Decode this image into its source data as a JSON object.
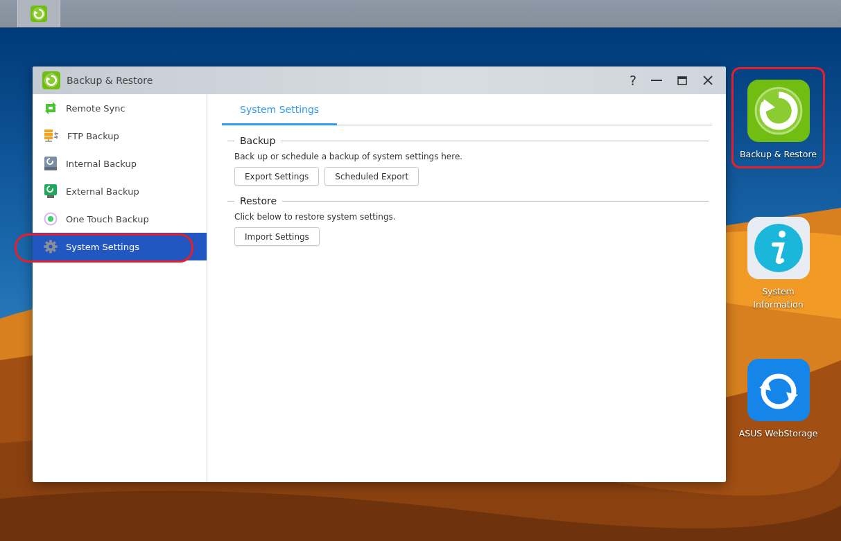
{
  "window": {
    "title": "Backup & Restore",
    "help": "?"
  },
  "sidebar": {
    "items": [
      {
        "label": "Remote Sync",
        "kind": "sync",
        "selected": false,
        "highlighted": false
      },
      {
        "label": "FTP Backup",
        "kind": "ftp",
        "selected": false,
        "highlighted": false
      },
      {
        "label": "Internal Backup",
        "kind": "internal",
        "selected": false,
        "highlighted": false
      },
      {
        "label": "External Backup",
        "kind": "external",
        "selected": false,
        "highlighted": false
      },
      {
        "label": "One Touch Backup",
        "kind": "onetouch",
        "selected": false,
        "highlighted": false
      },
      {
        "label": "System Settings",
        "kind": "gear",
        "selected": true,
        "highlighted": true
      }
    ]
  },
  "tabs": [
    {
      "label": "System Settings",
      "selected": true
    }
  ],
  "sections": [
    {
      "title": "Backup",
      "description": "Back up or schedule a backup of system settings here.",
      "buttons": [
        "Export Settings",
        "Scheduled Export"
      ]
    },
    {
      "title": "Restore",
      "description": "Click below to restore system settings.",
      "buttons": [
        "Import Settings"
      ]
    }
  ],
  "desktop_icons": [
    {
      "label": "Backup & Restore",
      "kind": "backup",
      "highlighted": true
    },
    {
      "label": "System Information",
      "kind": "info",
      "highlighted": false
    },
    {
      "label": "ASUS WebStorage",
      "kind": "webstorage",
      "highlighted": false
    }
  ]
}
